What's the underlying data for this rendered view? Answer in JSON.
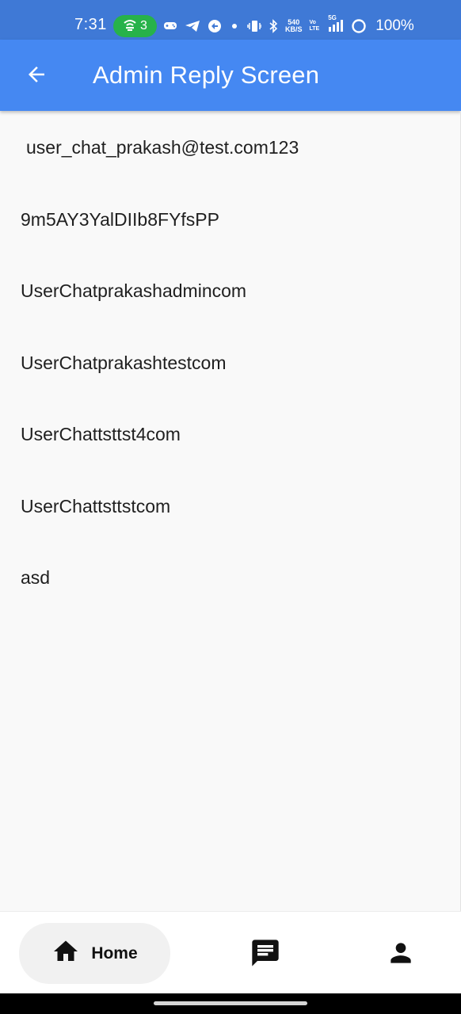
{
  "status_bar": {
    "time": "7:31",
    "hotspot_count": "3",
    "net_speed_value": "540",
    "net_speed_unit": "KB/S",
    "volte_top": "Vo",
    "volte_bottom": "LTE",
    "network_type": "5G",
    "battery_percent": "100%"
  },
  "app_bar": {
    "title": "Admin Reply Screen",
    "back_icon": "arrow-back-icon"
  },
  "chats": [
    "user_chat_prakash@test.com123",
    "9m5AY3YalDIIb8FYfsPP",
    "UserChatprakashadmincom",
    "UserChatprakashtestcom",
    "UserChattsttst4com",
    "UserChattsttstcom",
    "asd"
  ],
  "bottom_nav": {
    "home_label": "Home",
    "home_icon": "home-icon",
    "chat_icon": "message-icon",
    "profile_icon": "person-icon"
  },
  "colors": {
    "app_bar": "#4588f2",
    "status_bar": "#3f79d6",
    "hotspot_pill": "#27b24a",
    "background": "#f9f9f9"
  }
}
